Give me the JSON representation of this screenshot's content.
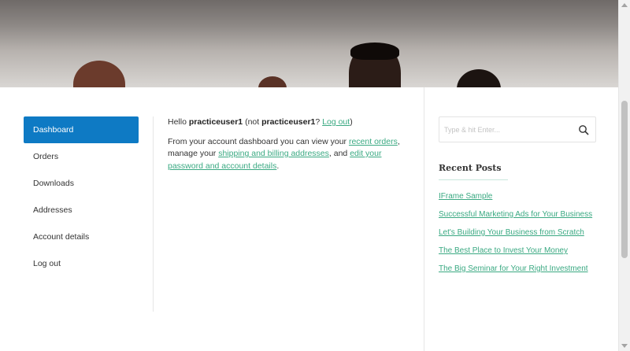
{
  "account": {
    "nav": [
      "Dashboard",
      "Orders",
      "Downloads",
      "Addresses",
      "Account details",
      "Log out"
    ],
    "greeting": {
      "hello": "Hello",
      "username": "practiceuser1",
      "not_prefix": "(not",
      "username2": "practiceuser1",
      "question": "?",
      "logout_link": "Log out",
      "close": ")"
    },
    "intro": {
      "t1": "From your account dashboard you can view your",
      "recent_orders": "recent orders",
      "t2": ", manage your",
      "addresses": "shipping and billing addresses",
      "t3": ", and",
      "edit": "edit your password and account details",
      "t4": "."
    }
  },
  "sidebar": {
    "search_placeholder": "Type & hit Enter...",
    "recent_posts_title": "Recent Posts",
    "recent_posts": [
      "IFrame Sample",
      "Successful Marketing Ads for Your Business",
      "Let's Building Your Business from Scratch",
      "The Best Place to Invest Your Money",
      "The Big Seminar for Your Right Investment"
    ]
  },
  "colors": {
    "accent": "#0e7ac4",
    "link": "#3aa982"
  },
  "icons": {
    "search": "search-icon"
  }
}
